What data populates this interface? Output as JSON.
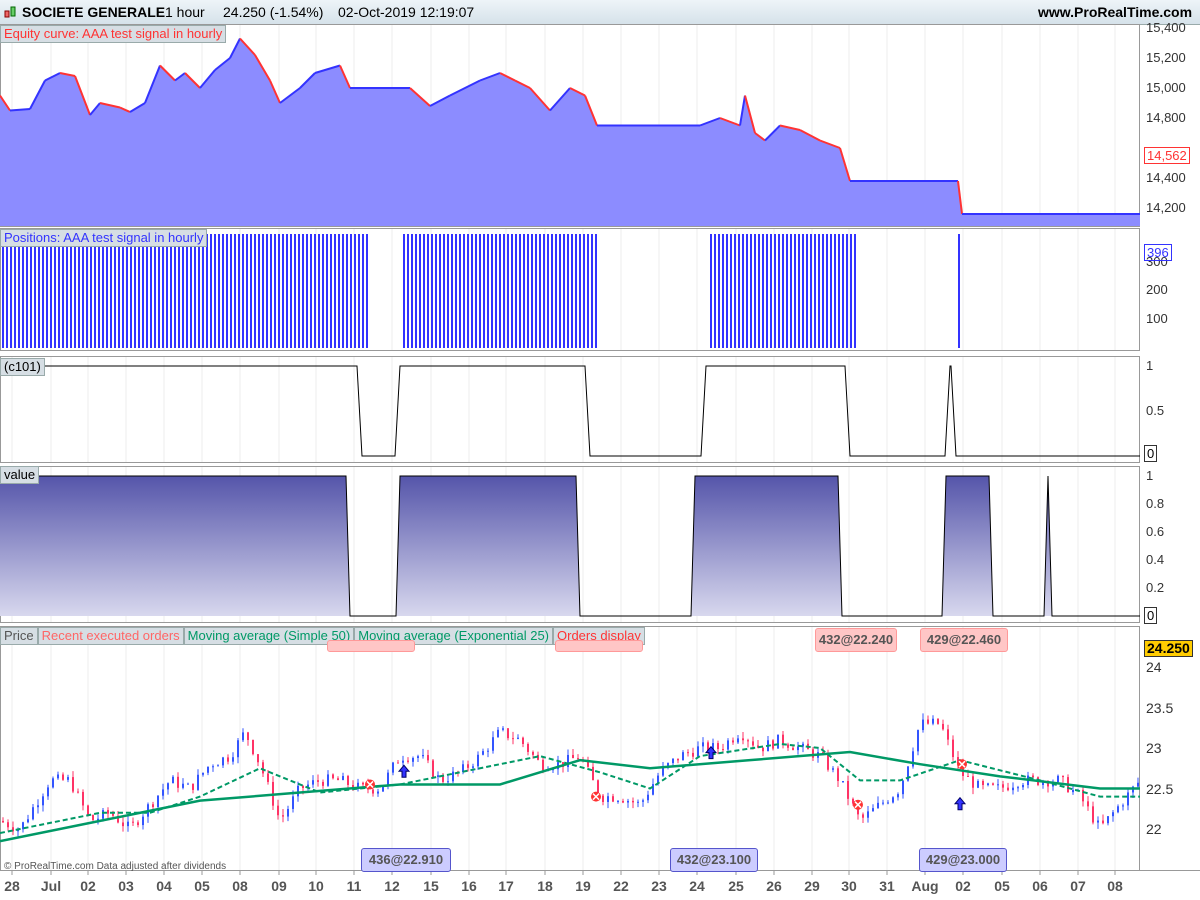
{
  "header": {
    "instrument": "SOCIETE GENERALE",
    "timeframe": "1 hour",
    "price_change": "24.250 (-1.54%)",
    "datetime": "02-Oct-2019 12:19:07",
    "site": "www.ProRealTime.com"
  },
  "panels": {
    "equity": {
      "title": "Equity curve: AAA test signal in hourly",
      "axis": [
        "15,400",
        "15,200",
        "15,000",
        "14,800",
        "14,400",
        "14,200"
      ],
      "last": "14,562",
      "points": [
        [
          0,
          14950
        ],
        [
          10,
          14850
        ],
        [
          30,
          14860
        ],
        [
          45,
          15050
        ],
        [
          60,
          15100
        ],
        [
          75,
          15080
        ],
        [
          90,
          14820
        ],
        [
          100,
          14900
        ],
        [
          120,
          14870
        ],
        [
          130,
          14840
        ],
        [
          145,
          14900
        ],
        [
          160,
          15150
        ],
        [
          175,
          15050
        ],
        [
          185,
          15100
        ],
        [
          200,
          15000
        ],
        [
          215,
          15120
        ],
        [
          230,
          15200
        ],
        [
          240,
          15330
        ],
        [
          255,
          15220
        ],
        [
          270,
          15050
        ],
        [
          280,
          14900
        ],
        [
          300,
          15000
        ],
        [
          315,
          15100
        ],
        [
          340,
          15150
        ],
        [
          350,
          15000
        ],
        [
          365,
          15000
        ],
        [
          410,
          15000
        ],
        [
          430,
          14880
        ],
        [
          450,
          14950
        ],
        [
          480,
          15050
        ],
        [
          500,
          15100
        ],
        [
          515,
          15050
        ],
        [
          530,
          15000
        ],
        [
          550,
          14850
        ],
        [
          570,
          15000
        ],
        [
          585,
          14950
        ],
        [
          597,
          14750
        ],
        [
          700,
          14750
        ],
        [
          720,
          14800
        ],
        [
          740,
          14750
        ],
        [
          745,
          14950
        ],
        [
          755,
          14700
        ],
        [
          765,
          14650
        ],
        [
          780,
          14750
        ],
        [
          800,
          14720
        ],
        [
          820,
          14650
        ],
        [
          840,
          14600
        ],
        [
          850,
          14380
        ],
        [
          958,
          14380
        ],
        [
          962,
          14160
        ],
        [
          1140,
          14160
        ]
      ]
    },
    "positions": {
      "title": "Positions: AAA test signal in hourly",
      "axis": [
        "300",
        "200",
        "100"
      ],
      "last": "396",
      "max": 396,
      "ranges": [
        [
          2,
          368
        ],
        [
          403,
          595
        ],
        [
          710,
          856
        ],
        [
          958,
          961
        ]
      ]
    },
    "c101": {
      "title": "(c101)",
      "axis": [
        "1",
        "0.5"
      ],
      "last": "0",
      "steps": [
        [
          0,
          1
        ],
        [
          362,
          0
        ],
        [
          400,
          1
        ],
        [
          590,
          0
        ],
        [
          706,
          1
        ],
        [
          850,
          0
        ],
        [
          950,
          1
        ],
        [
          956,
          0
        ],
        [
          1140,
          0
        ]
      ]
    },
    "value": {
      "title": "value",
      "axis": [
        "1",
        "0.8",
        "0.6",
        "0.4",
        "0.2"
      ],
      "last": "0",
      "steps": [
        [
          0,
          1
        ],
        [
          350,
          0
        ],
        [
          400,
          1
        ],
        [
          580,
          0
        ],
        [
          695,
          1
        ],
        [
          842,
          0
        ],
        [
          946,
          1
        ],
        [
          993,
          0
        ],
        [
          1048,
          1
        ],
        [
          1052,
          0
        ],
        [
          1140,
          0
        ]
      ]
    },
    "price": {
      "legend": [
        "Price",
        "Recent executed orders",
        "Moving average (Simple 50)",
        "Moving average (Exponential 25)",
        "Orders display"
      ],
      "axis": [
        "24",
        "23.5",
        "23",
        "22.5",
        "22"
      ],
      "last": "24.250",
      "close": [
        [
          0,
          22.1
        ],
        [
          20,
          22.0
        ],
        [
          50,
          22.6
        ],
        [
          70,
          22.6
        ],
        [
          90,
          22.1
        ],
        [
          110,
          22.2
        ],
        [
          130,
          22.0
        ],
        [
          150,
          22.3
        ],
        [
          170,
          22.6
        ],
        [
          190,
          22.5
        ],
        [
          210,
          22.8
        ],
        [
          230,
          22.9
        ],
        [
          245,
          23.2
        ],
        [
          260,
          22.8
        ],
        [
          280,
          22.1
        ],
        [
          300,
          22.5
        ],
        [
          320,
          22.6
        ],
        [
          340,
          22.6
        ],
        [
          360,
          22.5
        ],
        [
          380,
          22.5
        ],
        [
          400,
          22.9
        ],
        [
          420,
          22.9
        ],
        [
          440,
          22.6
        ],
        [
          460,
          22.7
        ],
        [
          480,
          22.9
        ],
        [
          500,
          23.2
        ],
        [
          520,
          23.1
        ],
        [
          540,
          22.8
        ],
        [
          560,
          22.8
        ],
        [
          580,
          22.9
        ],
        [
          600,
          22.4
        ],
        [
          620,
          22.4
        ],
        [
          640,
          22.3
        ],
        [
          660,
          22.7
        ],
        [
          680,
          22.9
        ],
        [
          700,
          23.0
        ],
        [
          720,
          23.0
        ],
        [
          740,
          23.2
        ],
        [
          760,
          23.0
        ],
        [
          780,
          23.1
        ],
        [
          800,
          23.0
        ],
        [
          820,
          22.9
        ],
        [
          840,
          22.6
        ],
        [
          860,
          22.1
        ],
        [
          880,
          22.3
        ],
        [
          900,
          22.5
        ],
        [
          920,
          23.3
        ],
        [
          940,
          23.3
        ],
        [
          960,
          22.7
        ],
        [
          980,
          22.5
        ],
        [
          1000,
          22.5
        ],
        [
          1020,
          22.6
        ],
        [
          1040,
          22.6
        ],
        [
          1060,
          22.6
        ],
        [
          1080,
          22.4
        ],
        [
          1100,
          22.0
        ],
        [
          1120,
          22.3
        ],
        [
          1140,
          22.6
        ]
      ],
      "sma50": [
        [
          0,
          21.85
        ],
        [
          100,
          22.1
        ],
        [
          200,
          22.35
        ],
        [
          300,
          22.45
        ],
        [
          400,
          22.55
        ],
        [
          500,
          22.55
        ],
        [
          580,
          22.85
        ],
        [
          650,
          22.75
        ],
        [
          750,
          22.85
        ],
        [
          850,
          22.95
        ],
        [
          920,
          22.8
        ],
        [
          1000,
          22.65
        ],
        [
          1100,
          22.5
        ],
        [
          1140,
          22.5
        ]
      ],
      "ema25": [
        [
          0,
          21.95
        ],
        [
          100,
          22.2
        ],
        [
          150,
          22.2
        ],
        [
          200,
          22.4
        ],
        [
          260,
          22.75
        ],
        [
          320,
          22.45
        ],
        [
          400,
          22.55
        ],
        [
          460,
          22.7
        ],
        [
          540,
          22.9
        ],
        [
          600,
          22.7
        ],
        [
          650,
          22.5
        ],
        [
          700,
          22.9
        ],
        [
          780,
          23.05
        ],
        [
          820,
          23.0
        ],
        [
          860,
          22.6
        ],
        [
          900,
          22.6
        ],
        [
          960,
          22.85
        ],
        [
          1040,
          22.6
        ],
        [
          1100,
          22.4
        ],
        [
          1140,
          22.4
        ]
      ],
      "exits": [
        [
          370,
          22.55
        ],
        [
          596,
          22.4
        ],
        [
          858,
          22.3
        ],
        [
          962,
          22.8
        ]
      ],
      "entries": [
        [
          404,
          22.7
        ],
        [
          711,
          22.93
        ],
        [
          960,
          22.3
        ]
      ],
      "orders_top": [
        "432@22.240",
        "429@22.460"
      ],
      "orders_bottom": [
        "436@22.910",
        "432@23.100",
        "429@23.000"
      ],
      "copyright": "© ProRealTime.com  Data adjusted after dividends"
    },
    "colors": {
      "equity_fill": "#8c8cff",
      "equity_up": "#3333ff",
      "equity_down": "#ff3333",
      "bars": "#3333ff",
      "sma": "#009966",
      "last_price": "#ffcc00"
    }
  },
  "xaxis": [
    "28",
    "Jul",
    "02",
    "03",
    "04",
    "05",
    "08",
    "09",
    "10",
    "11",
    "12",
    "15",
    "16",
    "17",
    "18",
    "19",
    "22",
    "23",
    "24",
    "25",
    "26",
    "29",
    "30",
    "31",
    "Aug",
    "02",
    "05",
    "06",
    "07",
    "08"
  ]
}
